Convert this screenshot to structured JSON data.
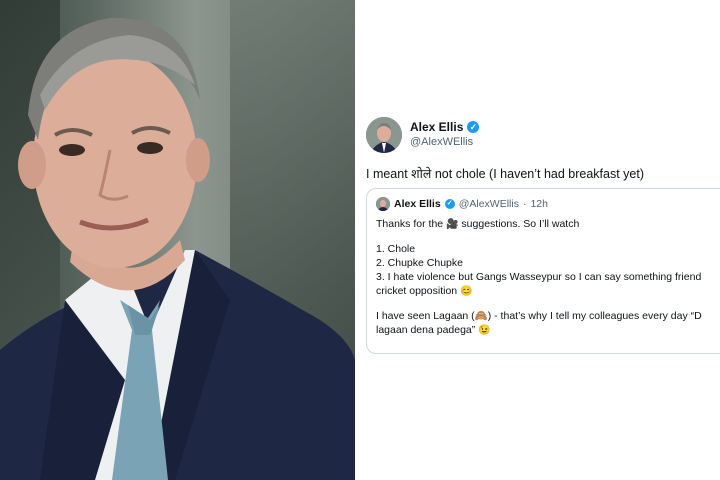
{
  "author": {
    "name": "Alex Ellis",
    "handle": "@AlexWEllis"
  },
  "tweet": {
    "text": "I meant शोले  not chole (I haven’t had breakfast yet)"
  },
  "quoted_tweet": {
    "name": "Alex Ellis",
    "handle": "@AlexWEllis",
    "separator": "·",
    "time": "12h",
    "line1_pre": "Thanks for the",
    "line1_emoji": "🎥",
    "line1_post": "suggestions. So I’ll watch",
    "list": [
      "1. Chole",
      "2. Chupke Chupke",
      "3. I hate violence but Gangs Wasseypur so I can say something friend"
    ],
    "list_cont": "cricket opposition",
    "list_cont_emoji": "😊",
    "para2_line1": "I have seen Lagaan (🙈) - that’s why I tell my colleagues every day “D",
    "para2_line2": "lagaan dena padega”",
    "para2_emoji": "😉"
  },
  "icons": {
    "verified": "verified-badge-icon",
    "camera": "movie-camera-icon"
  },
  "colors": {
    "verified": "#1d9bf0",
    "text": "#0f1419",
    "muted": "#536471",
    "border": "#cfd9de"
  }
}
